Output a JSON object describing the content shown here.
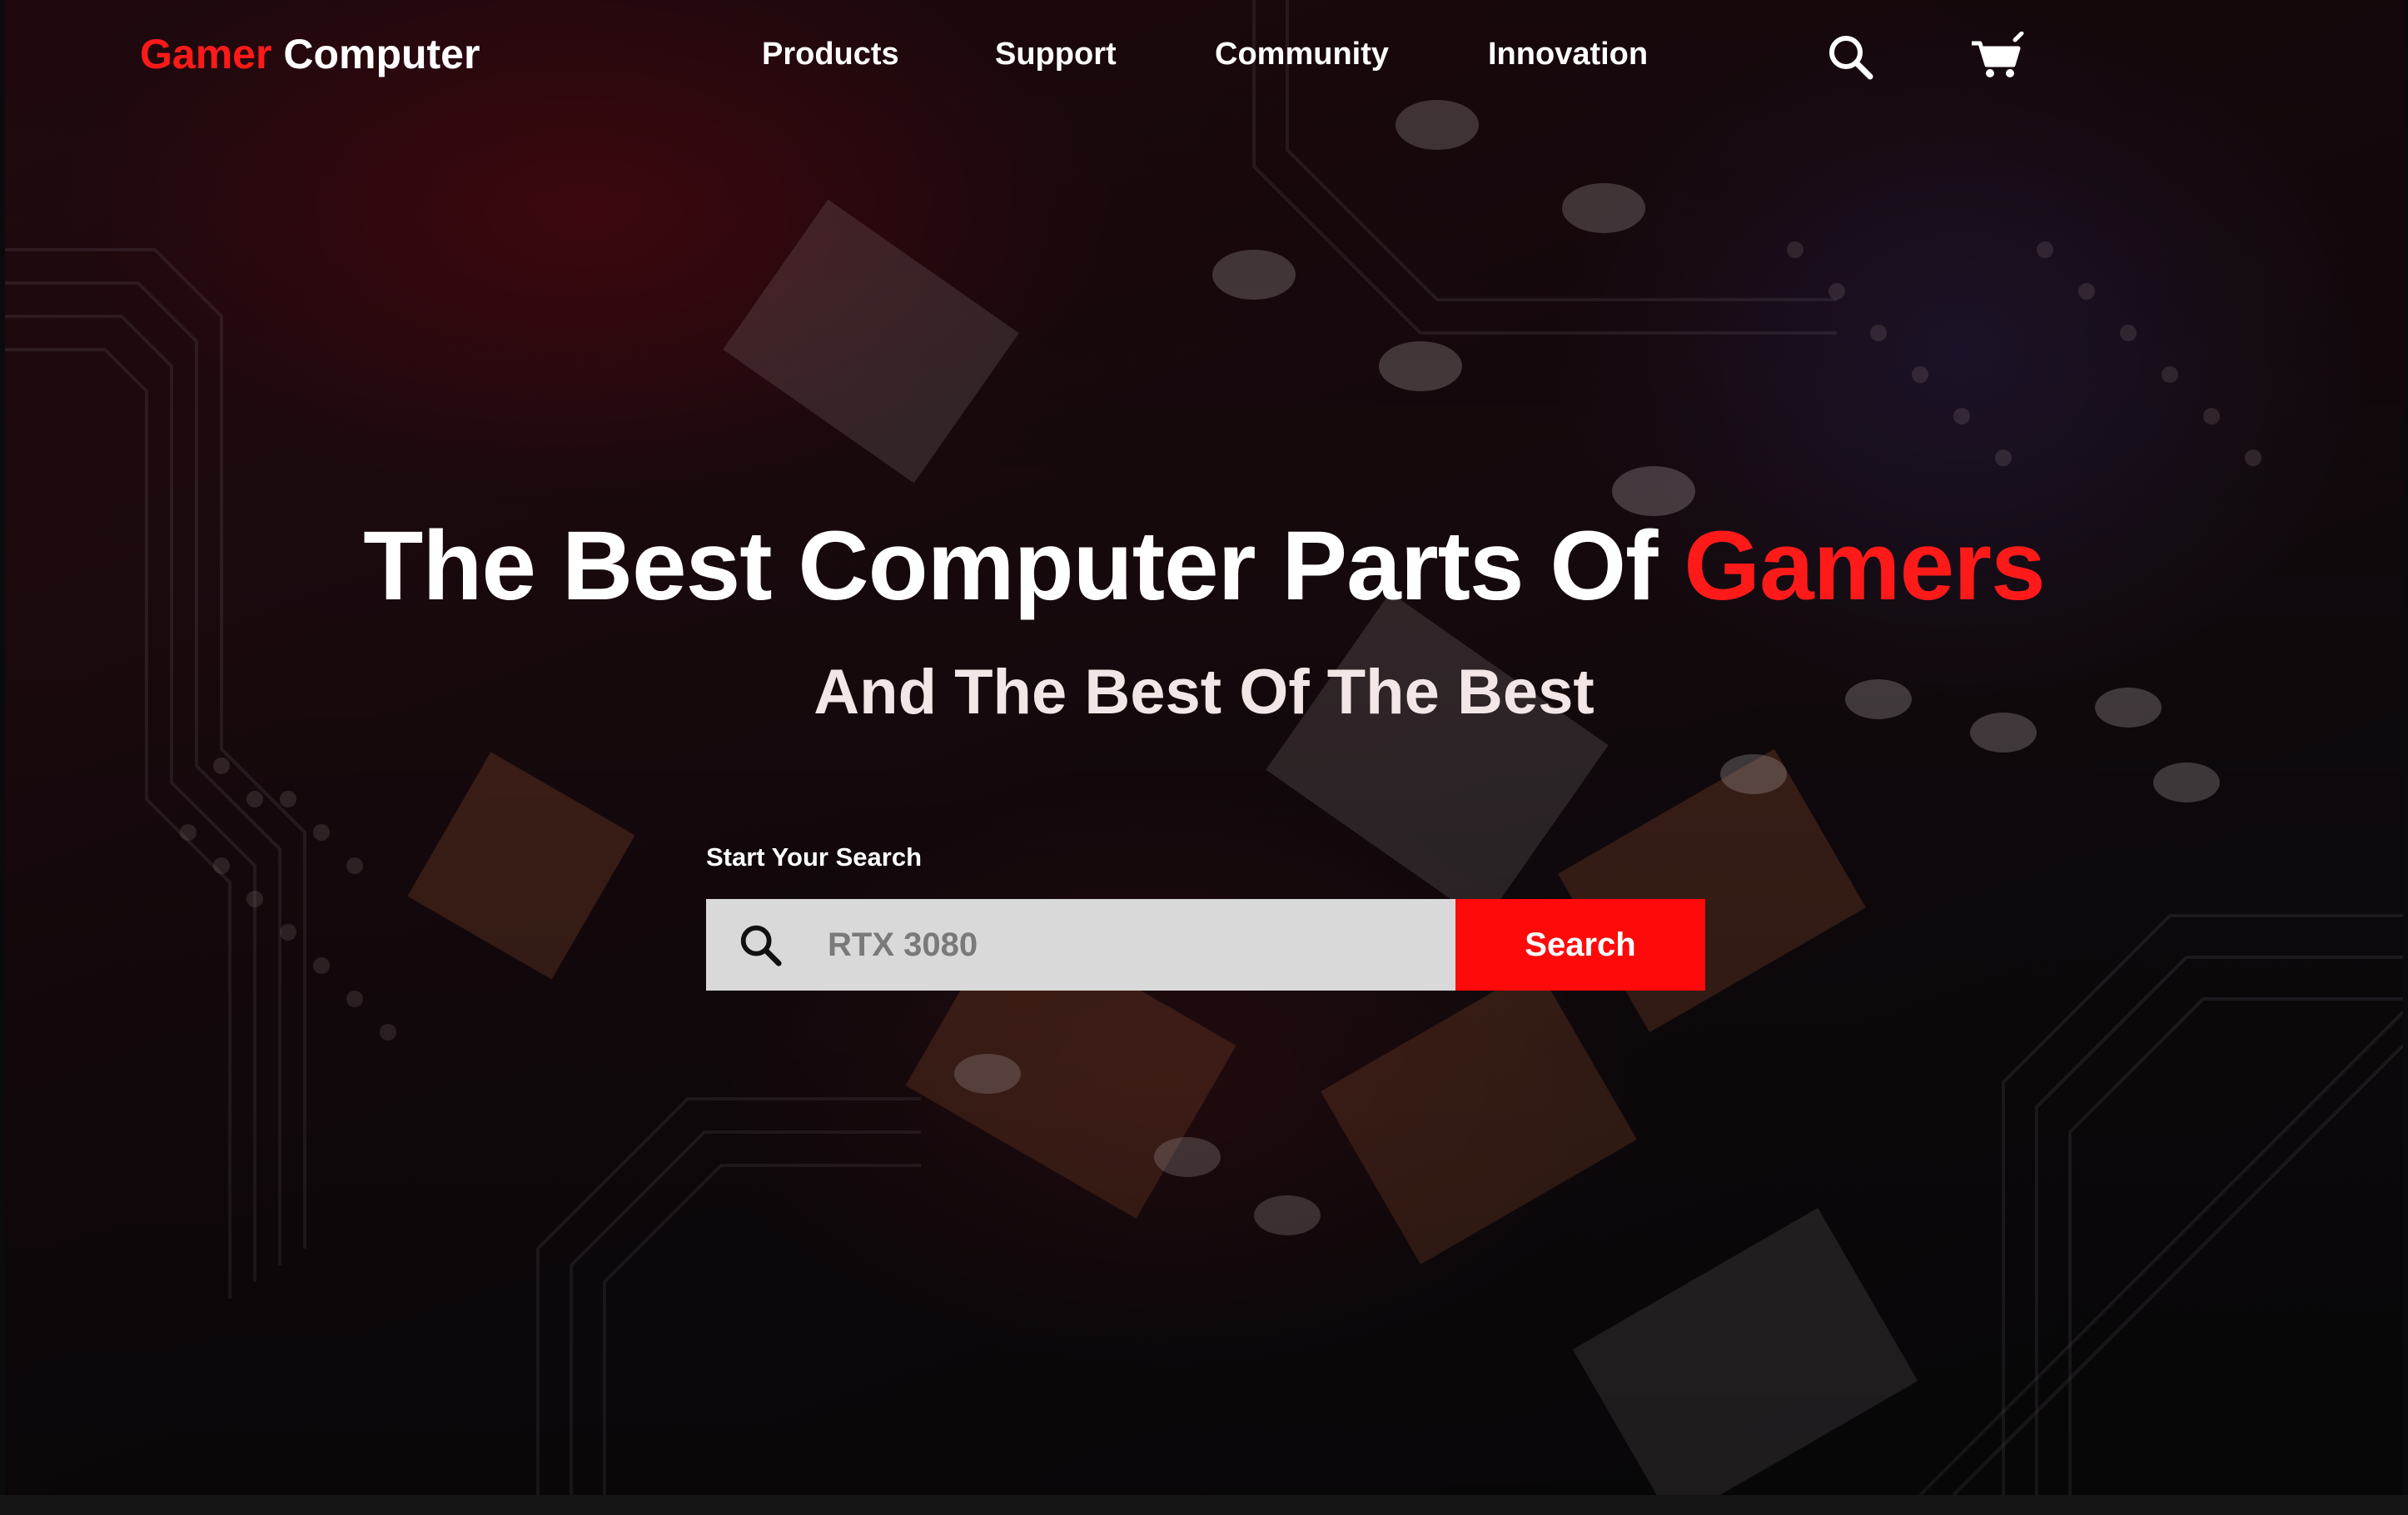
{
  "brand": {
    "name_accent": "Gamer",
    "name_rest": " Computer",
    "accent_color": "#ff1a1a"
  },
  "nav": {
    "links": [
      {
        "label": "Products"
      },
      {
        "label": "Support"
      },
      {
        "label": "Community"
      },
      {
        "label": "Innovation"
      }
    ],
    "search_icon": "search-icon",
    "cart_icon": "cart-icon"
  },
  "hero": {
    "headline_main": "The Best Computer Parts Of ",
    "headline_accent": "Gamers",
    "subheadline": "And The Best Of The Best",
    "background": "circuit-board-photo"
  },
  "search": {
    "label": "Start Your Search",
    "placeholder": "RTX 3080",
    "value": "",
    "button_label": "Search",
    "button_color": "#ff0a0a",
    "icon": "search-icon"
  }
}
